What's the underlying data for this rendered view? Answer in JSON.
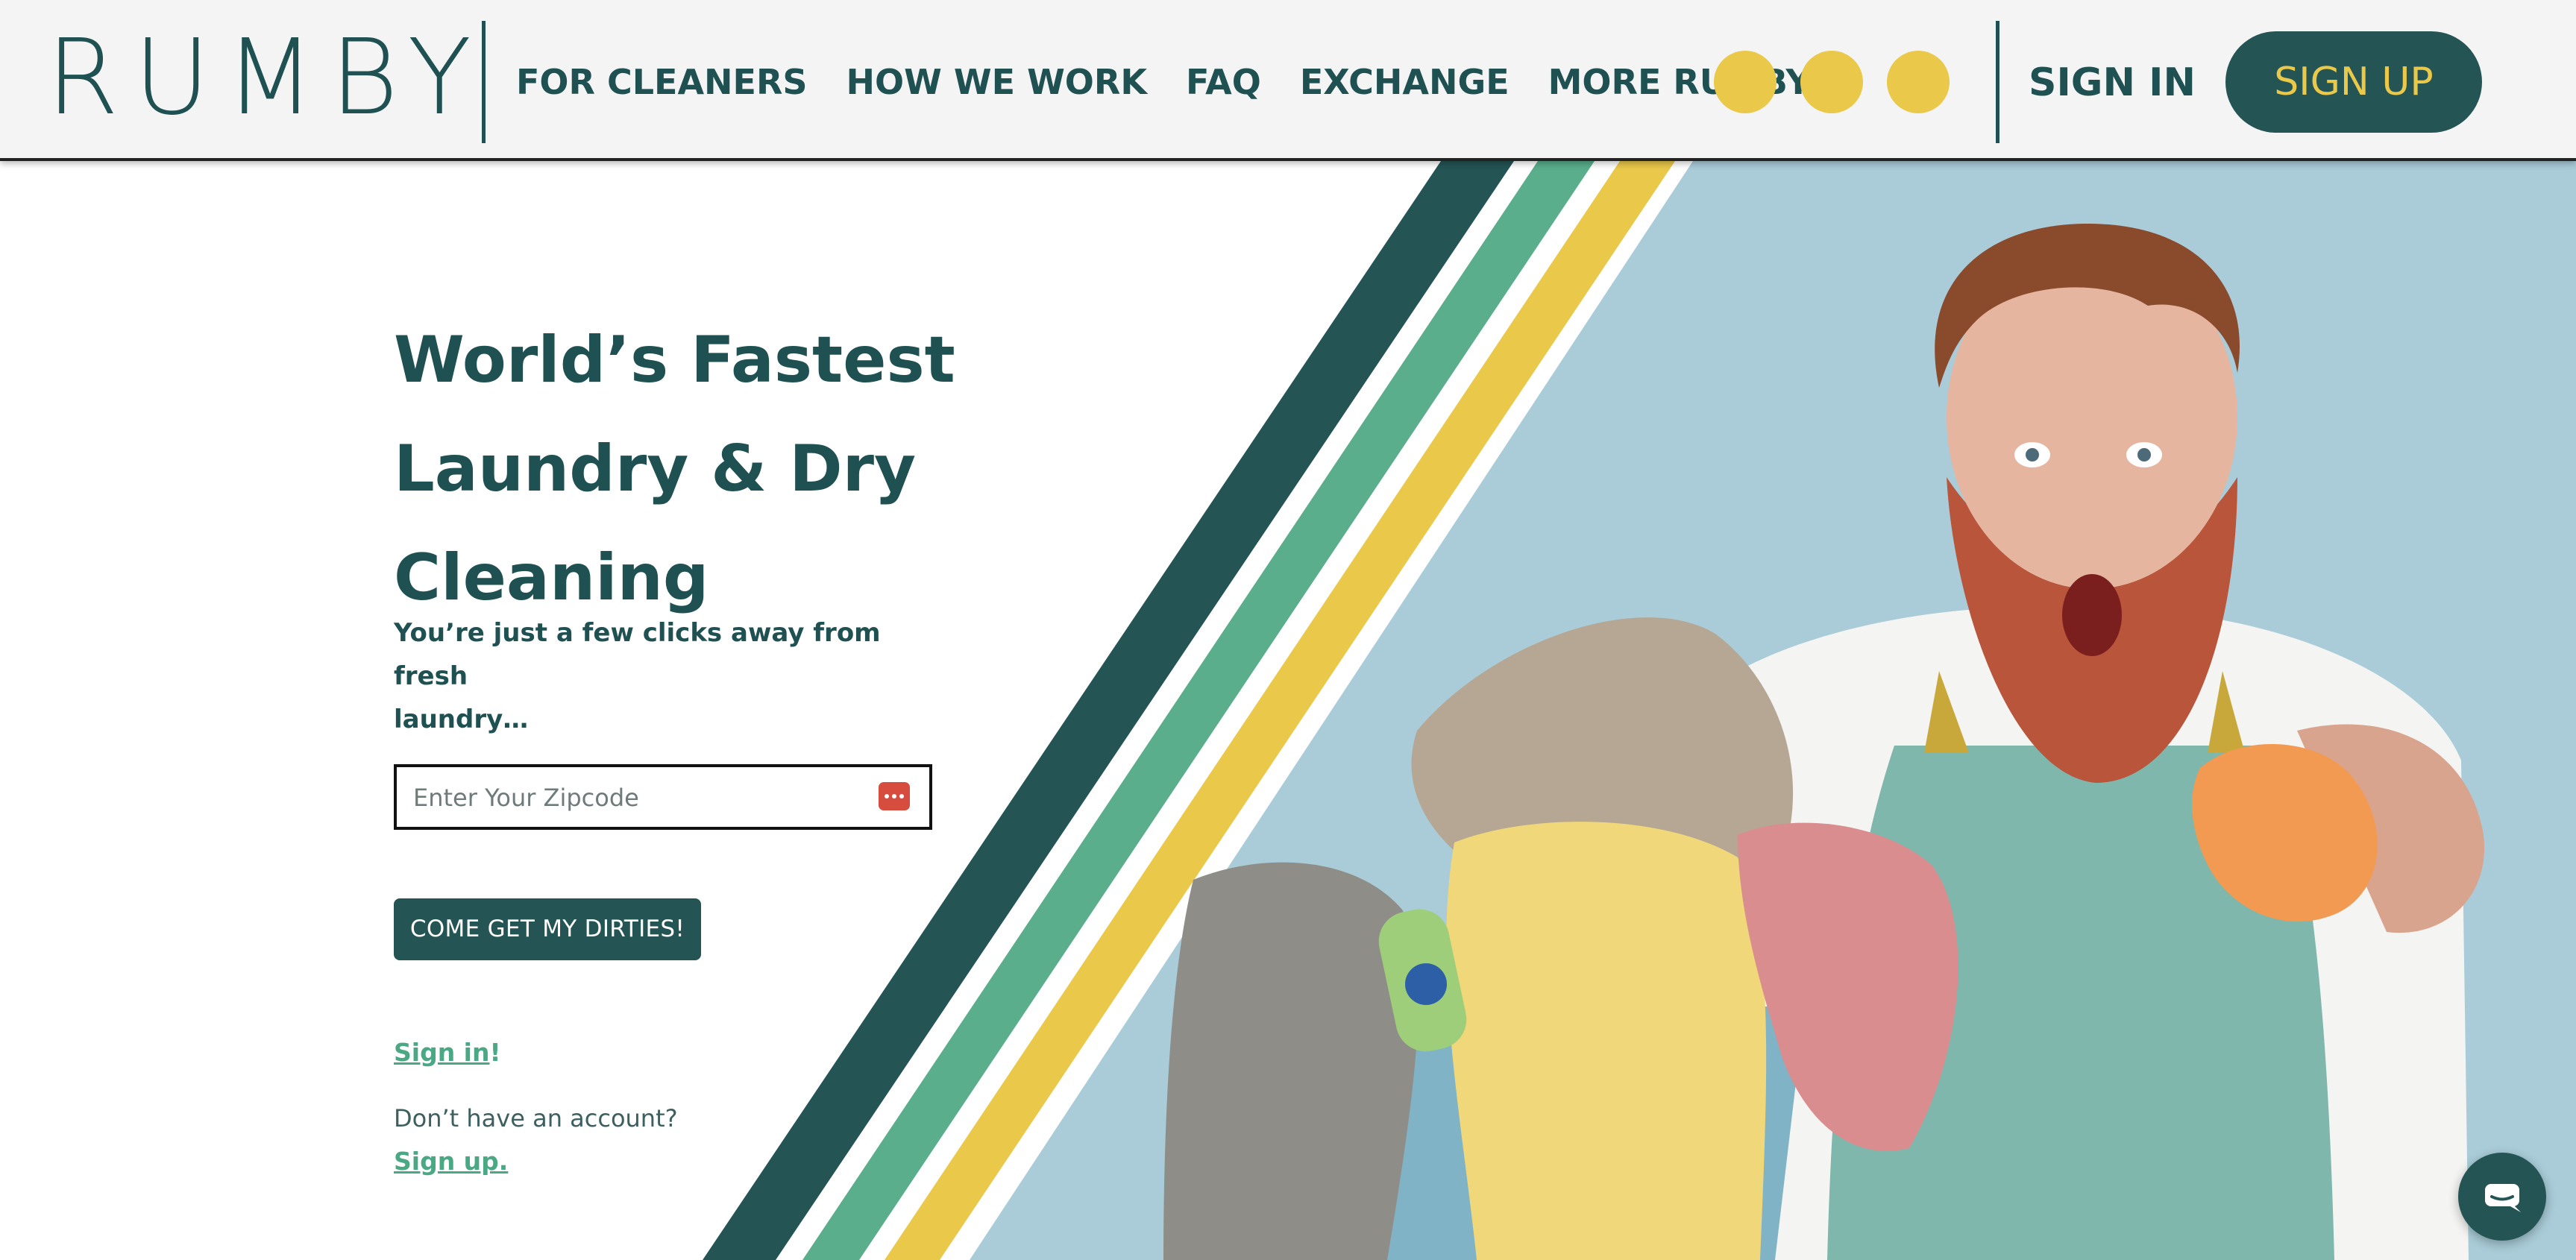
{
  "header": {
    "logo_text": "RUMBY",
    "nav": [
      {
        "label": "FOR CLEANERS"
      },
      {
        "label": "HOW WE WORK"
      },
      {
        "label": "FAQ"
      },
      {
        "label": "EXCHANGE"
      },
      {
        "label": "MORE RUMBY+"
      }
    ],
    "sign_in_label": "SIGN IN",
    "sign_up_label": "SIGN UP"
  },
  "hero": {
    "headline_line1": "World’s Fastest",
    "headline_line2": "Laundry & Dry",
    "headline_line3": "Cleaning",
    "subline_line1": "You’re just a few clicks away from fresh",
    "subline_line2": "laundry…",
    "zip_placeholder": "Enter Your Zipcode",
    "zip_value": "",
    "cta_label": "COME GET MY DIRTIES!",
    "signin_link": "Sign in",
    "signin_suffix": "!",
    "no_account_text": "Don’t have an account?",
    "signup_link": "Sign up."
  },
  "colors": {
    "brand_dark": "#245454",
    "brand_green": "#5aae8c",
    "brand_yellow": "#e9c84a",
    "photo_bg": "#a9ccd8",
    "header_bg": "#f3f4f3"
  },
  "icons": {
    "zip_field_icon": "password-manager-icon",
    "chat": "chat-bubble-icon",
    "header_dots": "yellow-dot"
  }
}
